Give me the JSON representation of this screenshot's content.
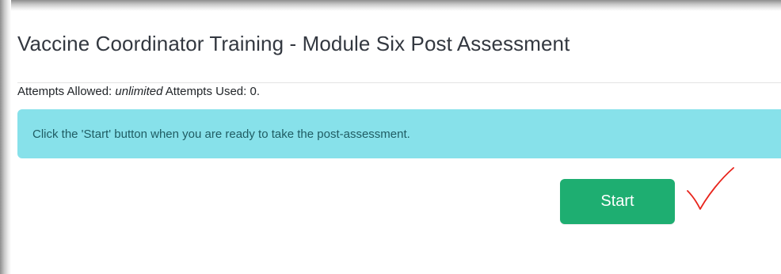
{
  "assessment": {
    "title": "Vaccine Coordinator Training - Module Six Post Assessment",
    "attempts_allowed_label": "Attempts Allowed:",
    "attempts_allowed_value": "unlimited",
    "attempts_used_label": "Attempts Used: 0."
  },
  "alert": {
    "message": "Click the 'Start' button when you are ready to take the post-assessment.",
    "color": "#87e1ea"
  },
  "actions": {
    "start_label": "Start",
    "start_color": "#1eae71"
  },
  "annotation": {
    "icon": "checkmark-icon",
    "color": "#e8241c"
  }
}
